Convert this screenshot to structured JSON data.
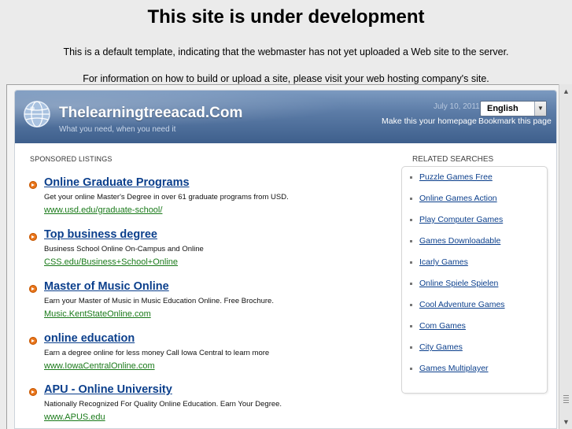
{
  "notice": {
    "title": "This site is under development",
    "line1": "This is a default template, indicating that the webmaster has not yet uploaded a Web site to the server.",
    "line2": "For information on how to build or upload a site, please visit your web hosting company's site."
  },
  "header": {
    "site_name": "Thelearningtreeacad.Com",
    "tagline": "What you need, when you need it",
    "date": "July 10, 2011",
    "language": "English",
    "homepage_link": "Make this your homepage",
    "bookmark_link": "Bookmark this page"
  },
  "sponsored": {
    "label": "SPONSORED LISTINGS",
    "listings": [
      {
        "title": "Online Graduate Programs",
        "desc": "Get your online Master's Degree in over 61 graduate programs from USD.",
        "url": "www.usd.edu/graduate-school/"
      },
      {
        "title": "Top business degree",
        "desc": "Business School Online On-Campus and Online",
        "url": "CSS.edu/Business+School+Online"
      },
      {
        "title": "Master of Music Online",
        "desc": "Earn your Master of Music in Music Education Online. Free Brochure.",
        "url": "Music.KentStateOnline.com"
      },
      {
        "title": "online education",
        "desc": "Earn a degree online for less money Call Iowa Central to learn more",
        "url": "www.IowaCentralOnline.com"
      },
      {
        "title": "APU - Online University",
        "desc": "Nationally Recognized For Quality Online Education. Earn Your Degree.",
        "url": "www.APUS.edu"
      }
    ]
  },
  "related": {
    "label": "RELATED SEARCHES",
    "items": [
      "Puzzle Games Free",
      "Online Games Action",
      "Play Computer Games",
      "Games Downloadable",
      "Icarly Games",
      "Online Spiele Spielen",
      "Cool Adventure Games",
      "Com Games",
      "City Games",
      "Games Multiplayer"
    ]
  },
  "colors": {
    "header_blue": "#4f6f9b",
    "link_blue": "#0b3f8c",
    "url_green": "#1a7a1a",
    "bullet_orange": "#e8741a"
  }
}
